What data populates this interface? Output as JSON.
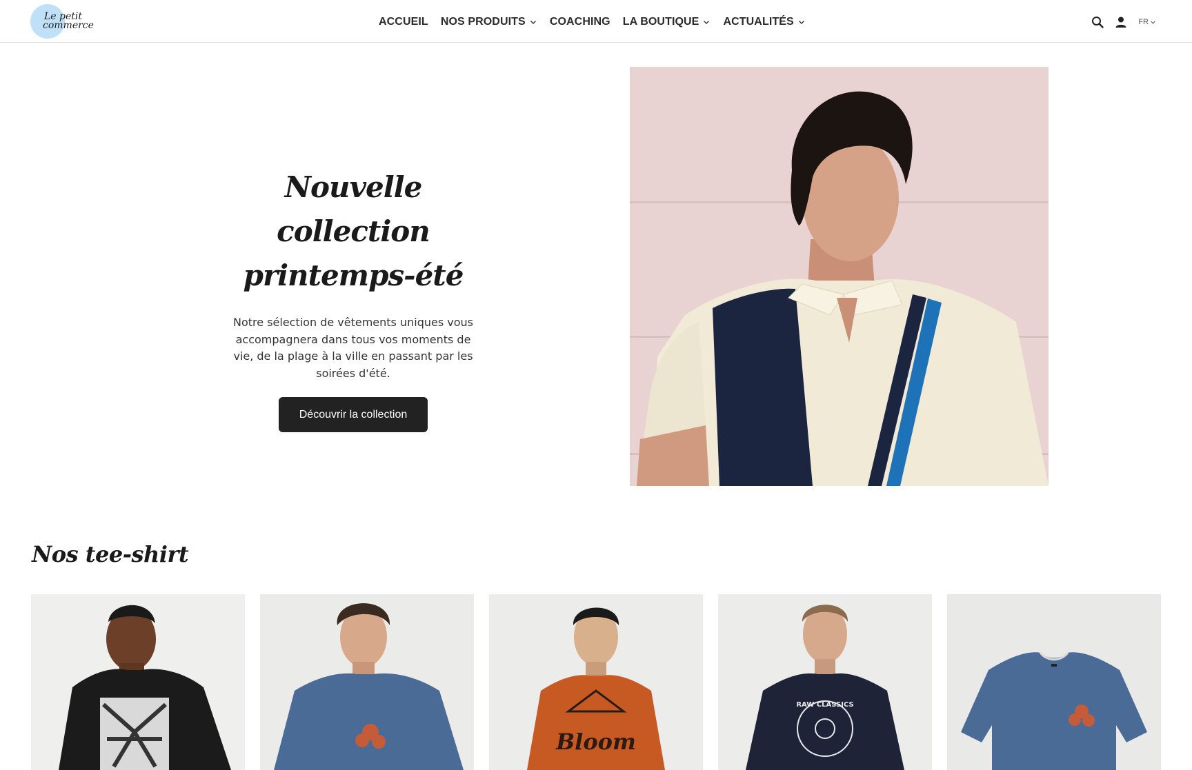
{
  "brand": {
    "logo_line1": "Le petit",
    "logo_line2": "commerce"
  },
  "nav": {
    "items": [
      {
        "label": "ACCUEIL",
        "has_dropdown": false
      },
      {
        "label": "NOS PRODUITS",
        "has_dropdown": true
      },
      {
        "label": "COACHING",
        "has_dropdown": false
      },
      {
        "label": "LA BOUTIQUE",
        "has_dropdown": true
      },
      {
        "label": "ACTUALITÉS",
        "has_dropdown": true
      }
    ]
  },
  "tools": {
    "search_icon": "search-icon",
    "account_icon": "user-icon",
    "language": "FR"
  },
  "hero": {
    "title_line1": "Nouvelle collection",
    "title_line2": "printemps-été",
    "description": "Notre sélection de vêtements uniques vous accompagnera dans tous vos moments de vie, de la plage à la ville en passant par les soirées d'été.",
    "cta_label": "Découvrir la collection"
  },
  "tees": {
    "title": "Nos tee-shirt",
    "items": [
      {
        "shirt_color": "#1b1b1b",
        "skin_color": "#6b3f28",
        "print": "palm"
      },
      {
        "shirt_color": "#4a6b96",
        "skin_color": "#d8a88a",
        "print": "flower"
      },
      {
        "shirt_color": "#c65a22",
        "skin_color": "#d9b08c",
        "print": "bloom",
        "print_text": "Bloom"
      },
      {
        "shirt_color": "#1e2338",
        "skin_color": "#d6a98c",
        "print": "classics",
        "print_text": "RAW CLASSICS"
      },
      {
        "shirt_color": "#4a6b96",
        "print": "flower-flat"
      }
    ]
  },
  "colors": {
    "button_bg": "#222222",
    "logo_disc": "#bfe0f7",
    "text_dark": "#1a1a1a"
  }
}
